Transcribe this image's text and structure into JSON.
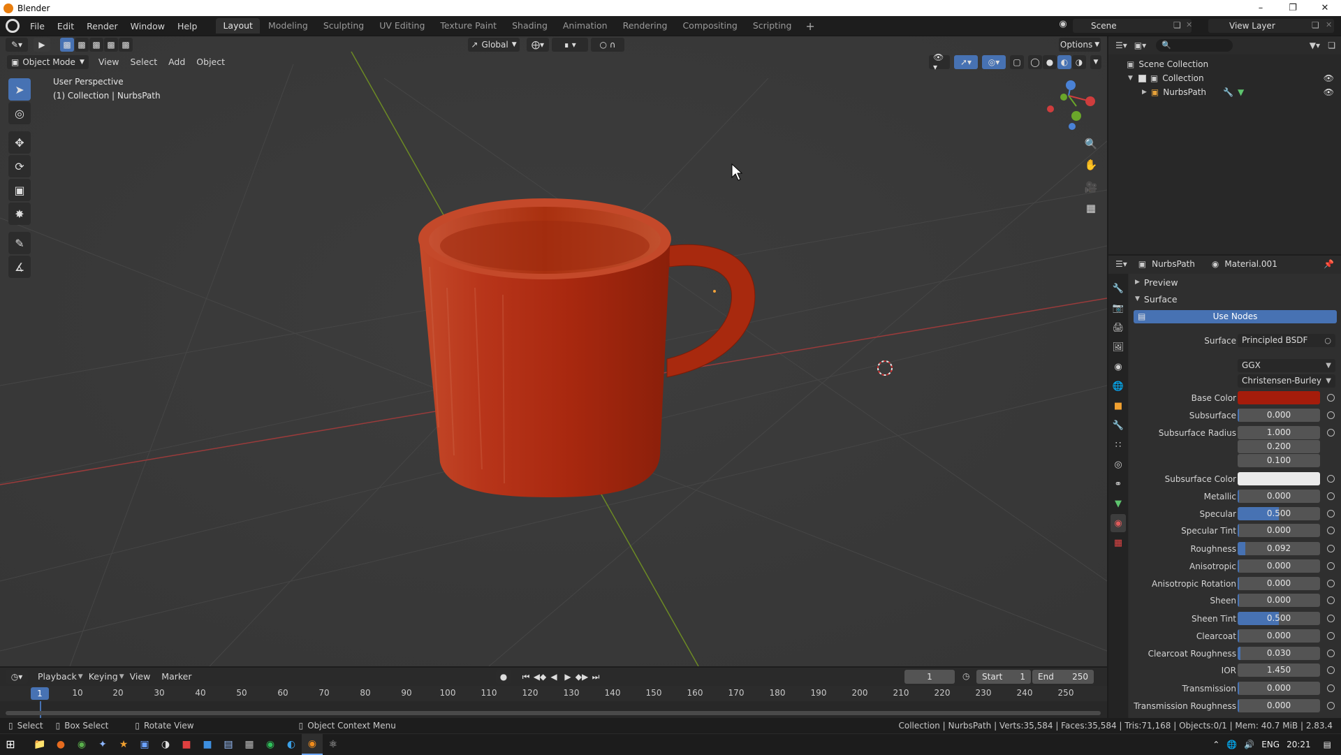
{
  "window": {
    "title": "Blender",
    "minimize": "–",
    "restore": "❐",
    "close": "✕"
  },
  "menu": [
    "File",
    "Edit",
    "Render",
    "Window",
    "Help"
  ],
  "workspaces": [
    "Layout",
    "Modeling",
    "Sculpting",
    "UV Editing",
    "Texture Paint",
    "Shading",
    "Animation",
    "Rendering",
    "Compositing",
    "Scripting"
  ],
  "active_workspace": "Layout",
  "scene": "Scene",
  "view_layer": "View Layer",
  "viewport": {
    "transform_orientation": "Global",
    "options_label": "Options",
    "mode": "Object Mode",
    "menus": [
      "View",
      "Select",
      "Add",
      "Object"
    ],
    "perspective_label": "User Perspective",
    "collection_label": "(1) Collection | NurbsPath"
  },
  "outliner": {
    "scene_collection": "Scene Collection",
    "collection": "Collection",
    "object": "NurbsPath"
  },
  "properties": {
    "object_name": "NurbsPath",
    "material_name": "Material.001",
    "preview_label": "Preview",
    "surface_section": "Surface",
    "use_nodes": "Use Nodes",
    "surface_label": "Surface",
    "surface_shader": "Principled BSDF",
    "distribution": "GGX",
    "subsurface_method": "Christensen-Burley",
    "base_color_label": "Base Color",
    "base_color": "#a51c0b",
    "subsurface_color": "#eaeaea",
    "rows": [
      {
        "label": "Subsurface",
        "value": "0.000",
        "fill": 0
      },
      {
        "label": "Subsurface Radius",
        "value": "1.000",
        "fill": 0
      },
      {
        "label": "",
        "value": "0.200",
        "fill": 0
      },
      {
        "label": "",
        "value": "0.100",
        "fill": 0
      },
      {
        "label": "Subsurface Color",
        "value": "",
        "fill": 0
      },
      {
        "label": "Metallic",
        "value": "0.000",
        "fill": 0
      },
      {
        "label": "Specular",
        "value": "0.500",
        "fill": 0.5
      },
      {
        "label": "Specular Tint",
        "value": "0.000",
        "fill": 0
      },
      {
        "label": "Roughness",
        "value": "0.092",
        "fill": 0.092
      },
      {
        "label": "Anisotropic",
        "value": "0.000",
        "fill": 0
      },
      {
        "label": "Anisotropic Rotation",
        "value": "0.000",
        "fill": 0
      },
      {
        "label": "Sheen",
        "value": "0.000",
        "fill": 0
      },
      {
        "label": "Sheen Tint",
        "value": "0.500",
        "fill": 0.5
      },
      {
        "label": "Clearcoat",
        "value": "0.000",
        "fill": 0
      },
      {
        "label": "Clearcoat Roughness",
        "value": "0.030",
        "fill": 0.03
      },
      {
        "label": "IOR",
        "value": "1.450",
        "fill": 0
      },
      {
        "label": "Transmission",
        "value": "0.000",
        "fill": 0
      },
      {
        "label": "Transmission Roughness",
        "value": "0.000",
        "fill": 0
      }
    ]
  },
  "timeline": {
    "menus": [
      "Playback",
      "Keying",
      "View",
      "Marker"
    ],
    "current_frame": "1",
    "start_label": "Start",
    "start": "1",
    "end_label": "End",
    "end": "250",
    "ticks": [
      "1",
      "10",
      "20",
      "30",
      "40",
      "50",
      "60",
      "70",
      "80",
      "90",
      "100",
      "110",
      "120",
      "130",
      "140",
      "150",
      "160",
      "170",
      "180",
      "190",
      "200",
      "210",
      "220",
      "230",
      "240",
      "250"
    ]
  },
  "statusbar": {
    "select": "Select",
    "box_select": "Box Select",
    "rotate_view": "Rotate View",
    "context_menu": "Object Context Menu",
    "stats": "Collection | NurbsPath | Verts:35,584 | Faces:35,584 | Tris:71,168 | Objects:0/1 | Mem: 40.7 MiB | 2.83.4"
  },
  "taskbar": {
    "lang": "ENG",
    "time": "20:21"
  },
  "colors": {
    "accent": "#4772b3",
    "mug": "#b2300f"
  }
}
